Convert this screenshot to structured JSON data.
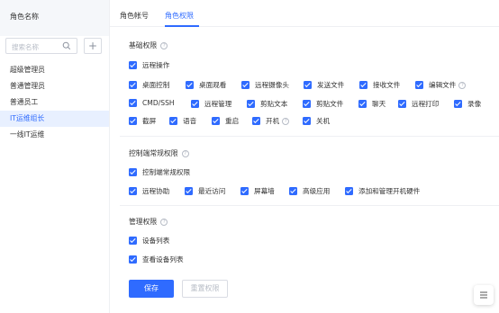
{
  "sidebar": {
    "header": "角色名称",
    "search_placeholder": "搜索名称",
    "add_label": "+",
    "roles": [
      "超级管理员",
      "普通管理员",
      "普通员工",
      "IT运维组长",
      "一线IT运维"
    ],
    "active_role": "IT运维组长"
  },
  "tabs": {
    "account": "角色帐号",
    "permission": "角色权限",
    "active": "角色权限"
  },
  "sections": {
    "basic": {
      "title": "基础权限",
      "master": "远程操作",
      "items": [
        "桌面控制",
        "桌面观看",
        "远程摄像头",
        "发送文件",
        "接收文件",
        "编辑文件",
        "CMD/SSH",
        "远程管理",
        "剪贴文本",
        "剪贴文件",
        "聊天",
        "远程打印",
        "录像",
        "截屏",
        "语音",
        "重启",
        "开机",
        "关机"
      ]
    },
    "control": {
      "title": "控制端常规权限",
      "master": "控制端常规权限",
      "items": [
        "远程协助",
        "最近访问",
        "屏幕墙",
        "高级应用",
        "添加和管理开机硬件"
      ]
    },
    "manage": {
      "title": "管理权限",
      "items": [
        "设备列表",
        "查看设备列表"
      ]
    }
  },
  "actions": {
    "save": "保存",
    "reset": "重置权限"
  },
  "colors": {
    "accent": "#2f6bff",
    "active_bg": "#e8f0ff"
  },
  "icons": {
    "search": "search-icon",
    "help": "question-circle-icon",
    "menu": "menu-icon"
  }
}
